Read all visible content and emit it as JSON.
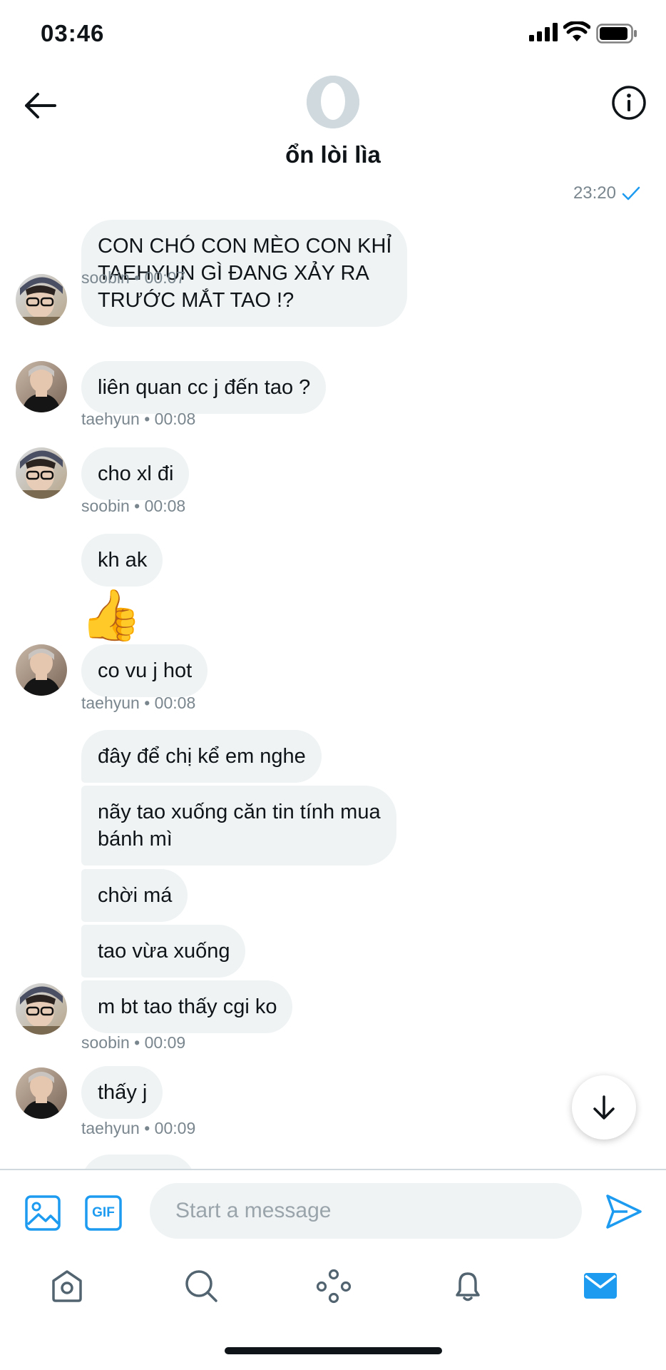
{
  "status_bar": {
    "time": "03:46"
  },
  "header": {
    "title": "ổn lòi lìa"
  },
  "last_sent_time": "23:20",
  "messages": [
    {
      "text": "CON CHÓ CON MÈO CON KHỈ\nTAEHYUN GÌ ĐANG XẢY RA\nTRƯỚC MẮT TAO !?",
      "meta": "soobin • 00:07"
    },
    {
      "text": "liên quan cc j đến tao ?",
      "meta": "taehyun • 00:08"
    },
    {
      "text": "cho xl đi",
      "meta": "soobin • 00:08"
    },
    {
      "text": "kh ak"
    },
    {
      "emoji": "👍"
    },
    {
      "text": "co vu j hot",
      "meta": "taehyun • 00:08"
    },
    {
      "text": "đây để chị kể em nghe"
    },
    {
      "text": "nãy tao xuống căn tin tính mua\nbánh mì"
    },
    {
      "text": "chời má"
    },
    {
      "text": "tao vừa xuống"
    },
    {
      "text": "m bt tao thấy cgi ko",
      "meta": "soobin • 00:09"
    },
    {
      "text": "thấy j",
      "meta": "taehyun • 00:09"
    }
  ],
  "composer": {
    "placeholder": "Start a message",
    "gif_label": "GIF"
  },
  "icons": {
    "back": "arrow-left-icon",
    "info": "info-icon",
    "media": "image-icon",
    "send": "send-icon",
    "scroll_down": "arrow-down-icon",
    "tabs": [
      "home-icon",
      "search-icon",
      "spaces-icon",
      "bell-icon",
      "mail-icon"
    ]
  },
  "colors": {
    "accent": "#1d9bf0",
    "bubble": "#eff3f4",
    "meta": "#7a868e"
  }
}
